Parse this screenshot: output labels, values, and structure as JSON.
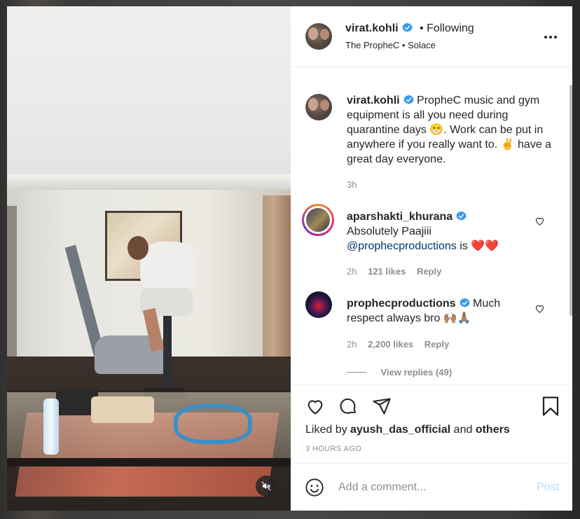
{
  "post": {
    "username": "virat.kohli",
    "following": "• Following",
    "audio_subtitle": "The PropheC • Solace"
  },
  "caption": {
    "username": "virat.kohli",
    "text": "PropheC music and gym equipment is all you need during quarantine days 😁. Work can be put in anywhere if you really want to. ✌️ have a great day everyone.",
    "time": "3h"
  },
  "comments": [
    {
      "username": "aparshakti_khurana",
      "text_before": "Absolutely Paajiii",
      "mention": "@prophecproductions",
      "text_after": "is ❤️❤️",
      "time": "2h",
      "likes": "121 likes",
      "reply": "Reply"
    },
    {
      "username": "prophecproductions",
      "text": "Much respect always bro 🙌🏽🙏🏽",
      "time": "2h",
      "likes": "2,200 likes",
      "reply": "Reply",
      "view_replies": "View replies (49)"
    }
  ],
  "likes": {
    "prefix": "Liked by",
    "user": "ayush_das_official",
    "and": "and",
    "others": "others"
  },
  "timestamp": "3 HOURS AGO",
  "add_comment": {
    "placeholder": "Add a comment...",
    "post_label": "Post"
  },
  "icons": [
    "verified-badge-icon",
    "more-options-icon",
    "heart-icon",
    "comment-icon",
    "share-icon",
    "bookmark-icon",
    "emoji-icon",
    "mute-icon"
  ],
  "colors": {
    "verified": "#3897f0",
    "post_disabled": "#b2dffc",
    "mention": "#00376b",
    "secondary_text": "#8e8e8e"
  }
}
